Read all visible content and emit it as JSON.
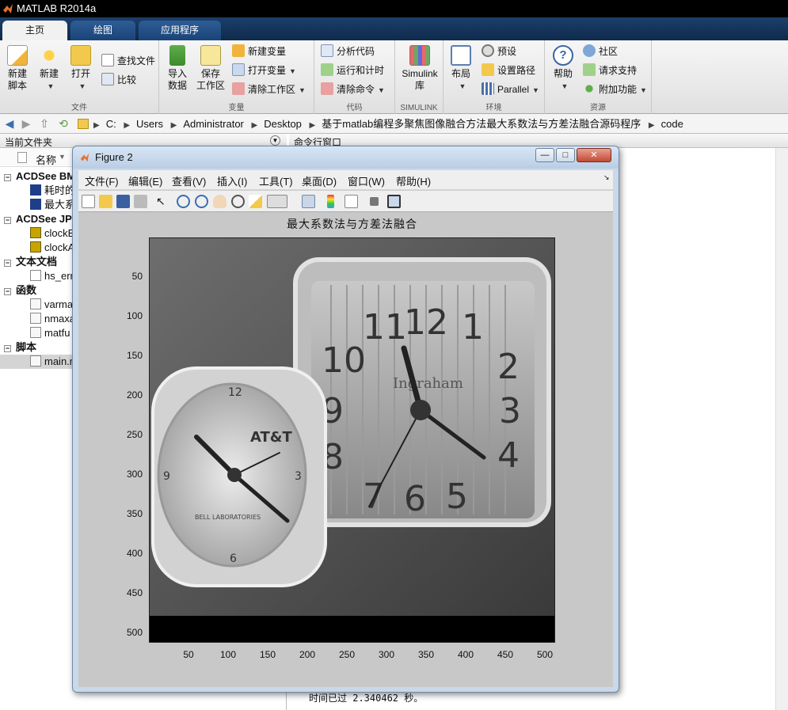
{
  "app": {
    "title": "MATLAB R2014a"
  },
  "tabs": [
    {
      "label": "主页"
    },
    {
      "label": "绘图"
    },
    {
      "label": "应用程序"
    }
  ],
  "ribbon": {
    "file": {
      "label": "文件",
      "new_script": "新建\n脚本",
      "new": "新建",
      "open": "打开",
      "find_files": "查找文件",
      "compare": "比较"
    },
    "variable": {
      "label": "变量",
      "import": "导入\n数据",
      "save_ws": "保存\n工作区",
      "new_var": "新建变量",
      "open_var": "打开变量",
      "clear_ws": "清除工作区"
    },
    "code": {
      "label": "代码",
      "analyze": "分析代码",
      "run_time": "运行和计时",
      "clear_cmd": "清除命令"
    },
    "simulink": {
      "label": "SIMULINK",
      "btn": "Simulink\n库"
    },
    "env": {
      "label": "环境",
      "layout": "布局",
      "prefs": "预设",
      "set_path": "设置路径",
      "parallel": "Parallel"
    },
    "resources": {
      "label": "资源",
      "help": "帮助",
      "community": "社区",
      "support": "请求支持",
      "addons": "附加功能"
    }
  },
  "address": {
    "crumbs": [
      "C:",
      "Users",
      "Administrator",
      "Desktop",
      "基于matlab编程多聚焦图像融合方法最大系数法与方差法融合源码程序",
      "code"
    ]
  },
  "panels": {
    "current_folder": "当前文件夹",
    "command_window": "命令行窗口",
    "name_col": "名称"
  },
  "tree": {
    "sections": [
      "ACDSee BMP",
      "ACDSee JPE",
      "文本文档",
      "函数",
      "脚本"
    ],
    "bmp_files": [
      "耗时的",
      "最大系"
    ],
    "jpg_files": [
      "clockB",
      "clockA"
    ],
    "txt_files": [
      "hs_err"
    ],
    "func_files": [
      "varma",
      "nmaxa",
      "matfu"
    ],
    "script_files": [
      "main.m"
    ]
  },
  "command_output": "时间已过 2.340462 秒。",
  "figure": {
    "title": "Figure 2",
    "menu": [
      "文件(F)",
      "编辑(E)",
      "查看(V)",
      "插入(I)",
      "工具(T)",
      "桌面(D)",
      "窗口(W)",
      "帮助(H)"
    ],
    "plot_title": "最大系数法与方差法融合",
    "yticks": [
      "50",
      "100",
      "150",
      "200",
      "250",
      "300",
      "350",
      "400",
      "450",
      "500"
    ],
    "xticks": [
      "50",
      "100",
      "150",
      "200",
      "250",
      "300",
      "350",
      "400",
      "450",
      "500"
    ],
    "clock_text": {
      "brand_left": "AT&T",
      "sub_left": "BELL LABORATORIES",
      "brand_right": "Ingraham",
      "numerals_right": [
        "11",
        "12",
        "1",
        "2",
        "3",
        "4",
        "5",
        "6",
        "7",
        "8",
        "9",
        "10"
      ],
      "numerals_left": [
        "12",
        "3",
        "6",
        "9"
      ]
    }
  }
}
